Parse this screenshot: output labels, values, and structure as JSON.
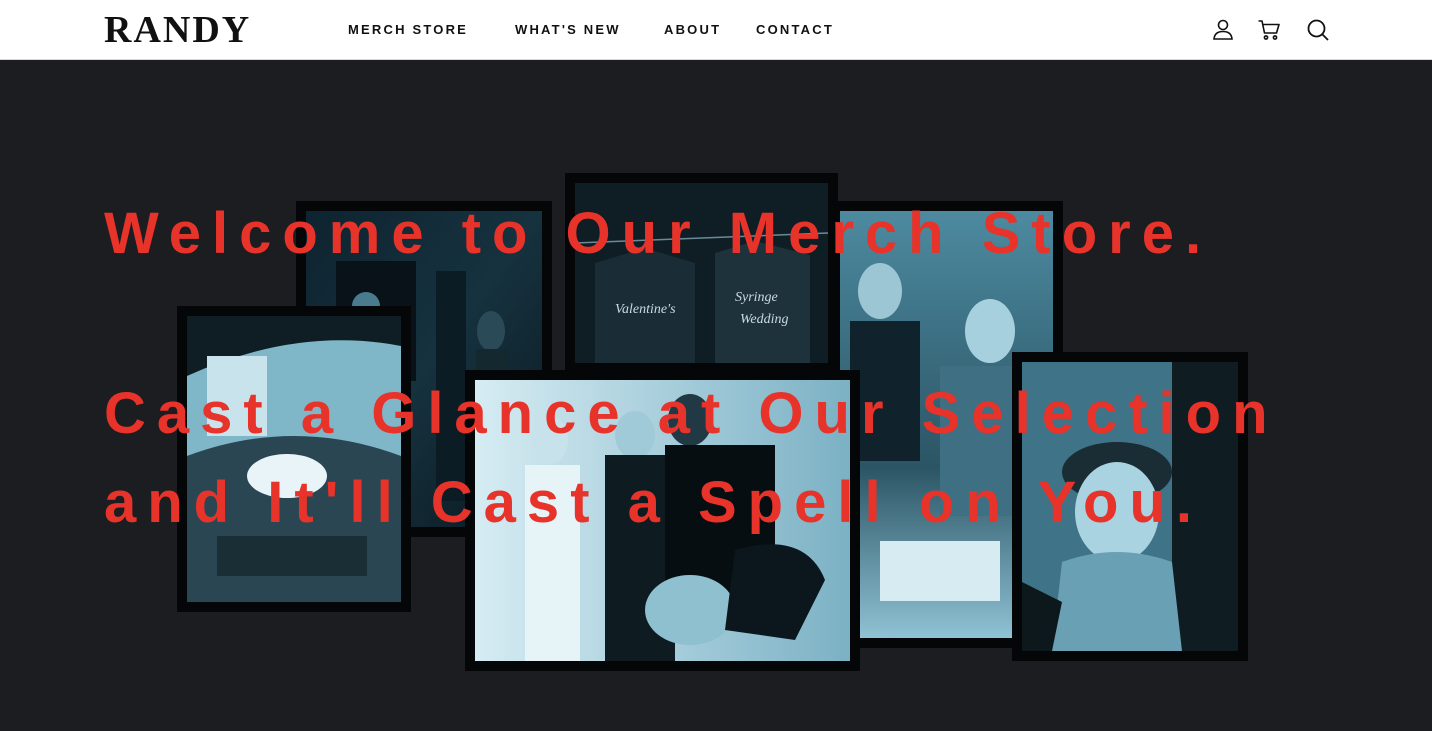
{
  "brand": {
    "name": "RANDY"
  },
  "nav": {
    "items": [
      "MERCH STORE",
      "WHAT'S NEW",
      "ABOUT",
      "CONTACT"
    ]
  },
  "header_icons": [
    "account-icon",
    "cart-icon",
    "search-icon"
  ],
  "hero": {
    "line1": "Welcome to Our Merch Store.",
    "line2": "Cast a Glance at Our Selection",
    "line3": "and It'll Cast a Spell on You.",
    "text_color": "#e8332a",
    "background": "#1b1d21",
    "photos": [
      "car-interior-photo",
      "dark-hallway-photo",
      "merch-shirts-photo",
      "group-sitting-photo",
      "friends-group-photo",
      "cap-portrait-photo"
    ]
  }
}
